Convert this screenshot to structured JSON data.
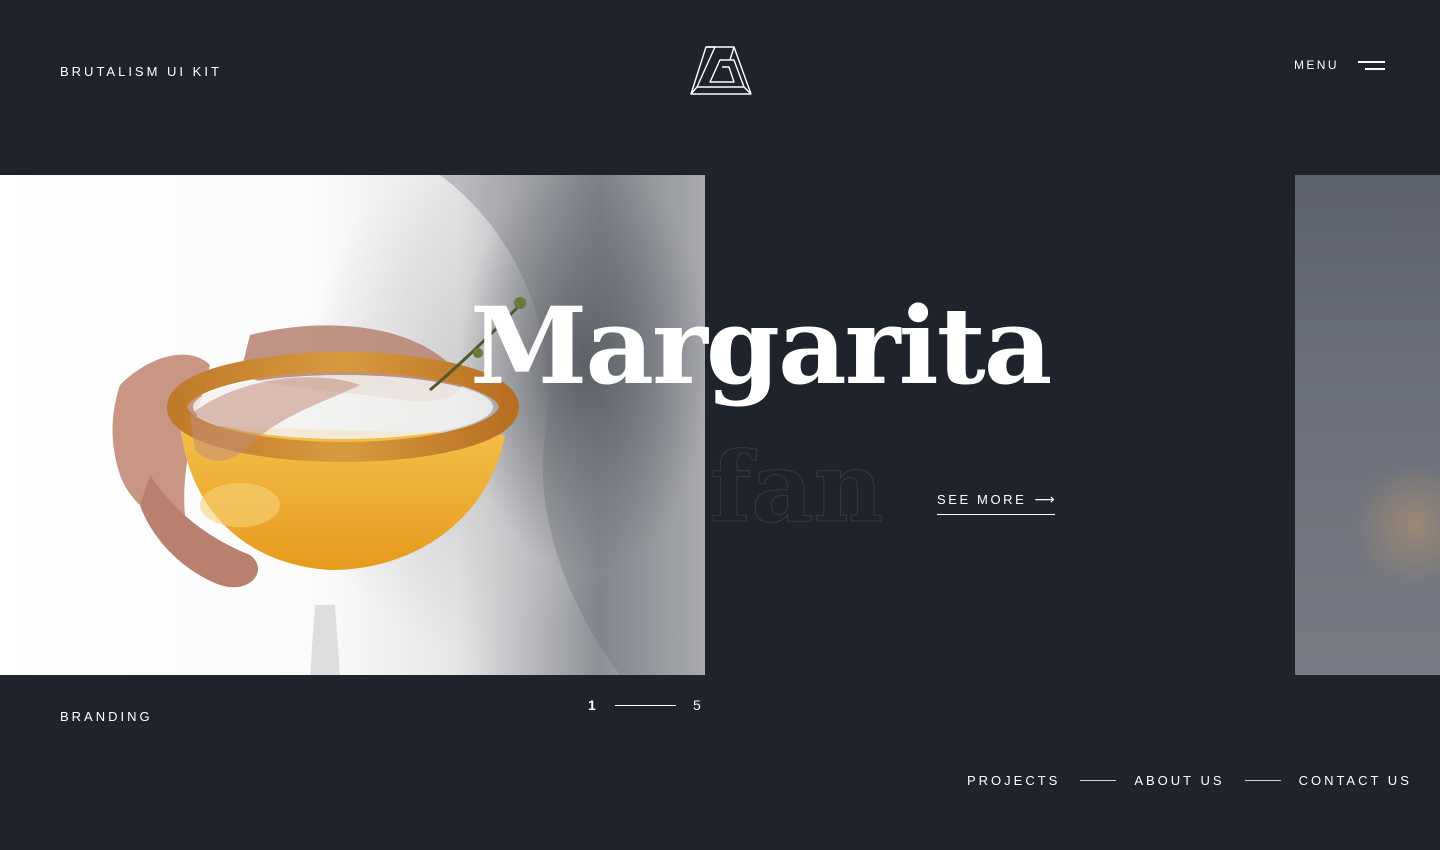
{
  "header": {
    "brand": "BRUTALISM UI KIT",
    "logo_icon": "impossible-triangle-logo",
    "menu_label": "MENU",
    "menu_icon": "hamburger-icon"
  },
  "hero": {
    "title": "Margarita",
    "subtitle": "fan",
    "cta_label": "SEE MORE",
    "cta_arrow": "⟶",
    "image_subject": "margarita cocktail glass with salted rim held in hands"
  },
  "footer": {
    "category": "BRANDING",
    "pager": {
      "current": "1",
      "total": "5"
    },
    "nav": [
      {
        "label": "PROJECTS"
      },
      {
        "label": "ABOUT US"
      },
      {
        "label": "CONTACT US"
      }
    ]
  },
  "colors": {
    "background": "#1f232c",
    "text": "#ffffff",
    "outline_text": "#343944"
  }
}
